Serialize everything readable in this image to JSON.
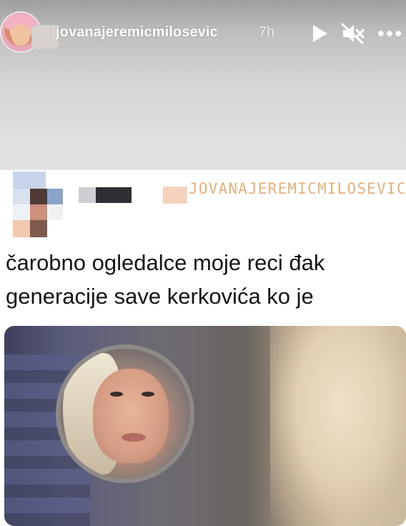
{
  "story_header": {
    "username": "jovanajeremicmilosevic",
    "timestamp": "7h",
    "icons": [
      "avatar-image",
      "play-icon",
      "mute-icon",
      "more-icon"
    ]
  },
  "post": {
    "watermark": "JOVANAJEREMICMILOSEVIC",
    "text_lines": [
      "čarobno ogledalce moje reci đak",
      "generacije save kerkovića ko je"
    ]
  },
  "colors": {
    "watermark": "#e7b07a",
    "text": "#151515",
    "header_text": "#ffffff"
  }
}
